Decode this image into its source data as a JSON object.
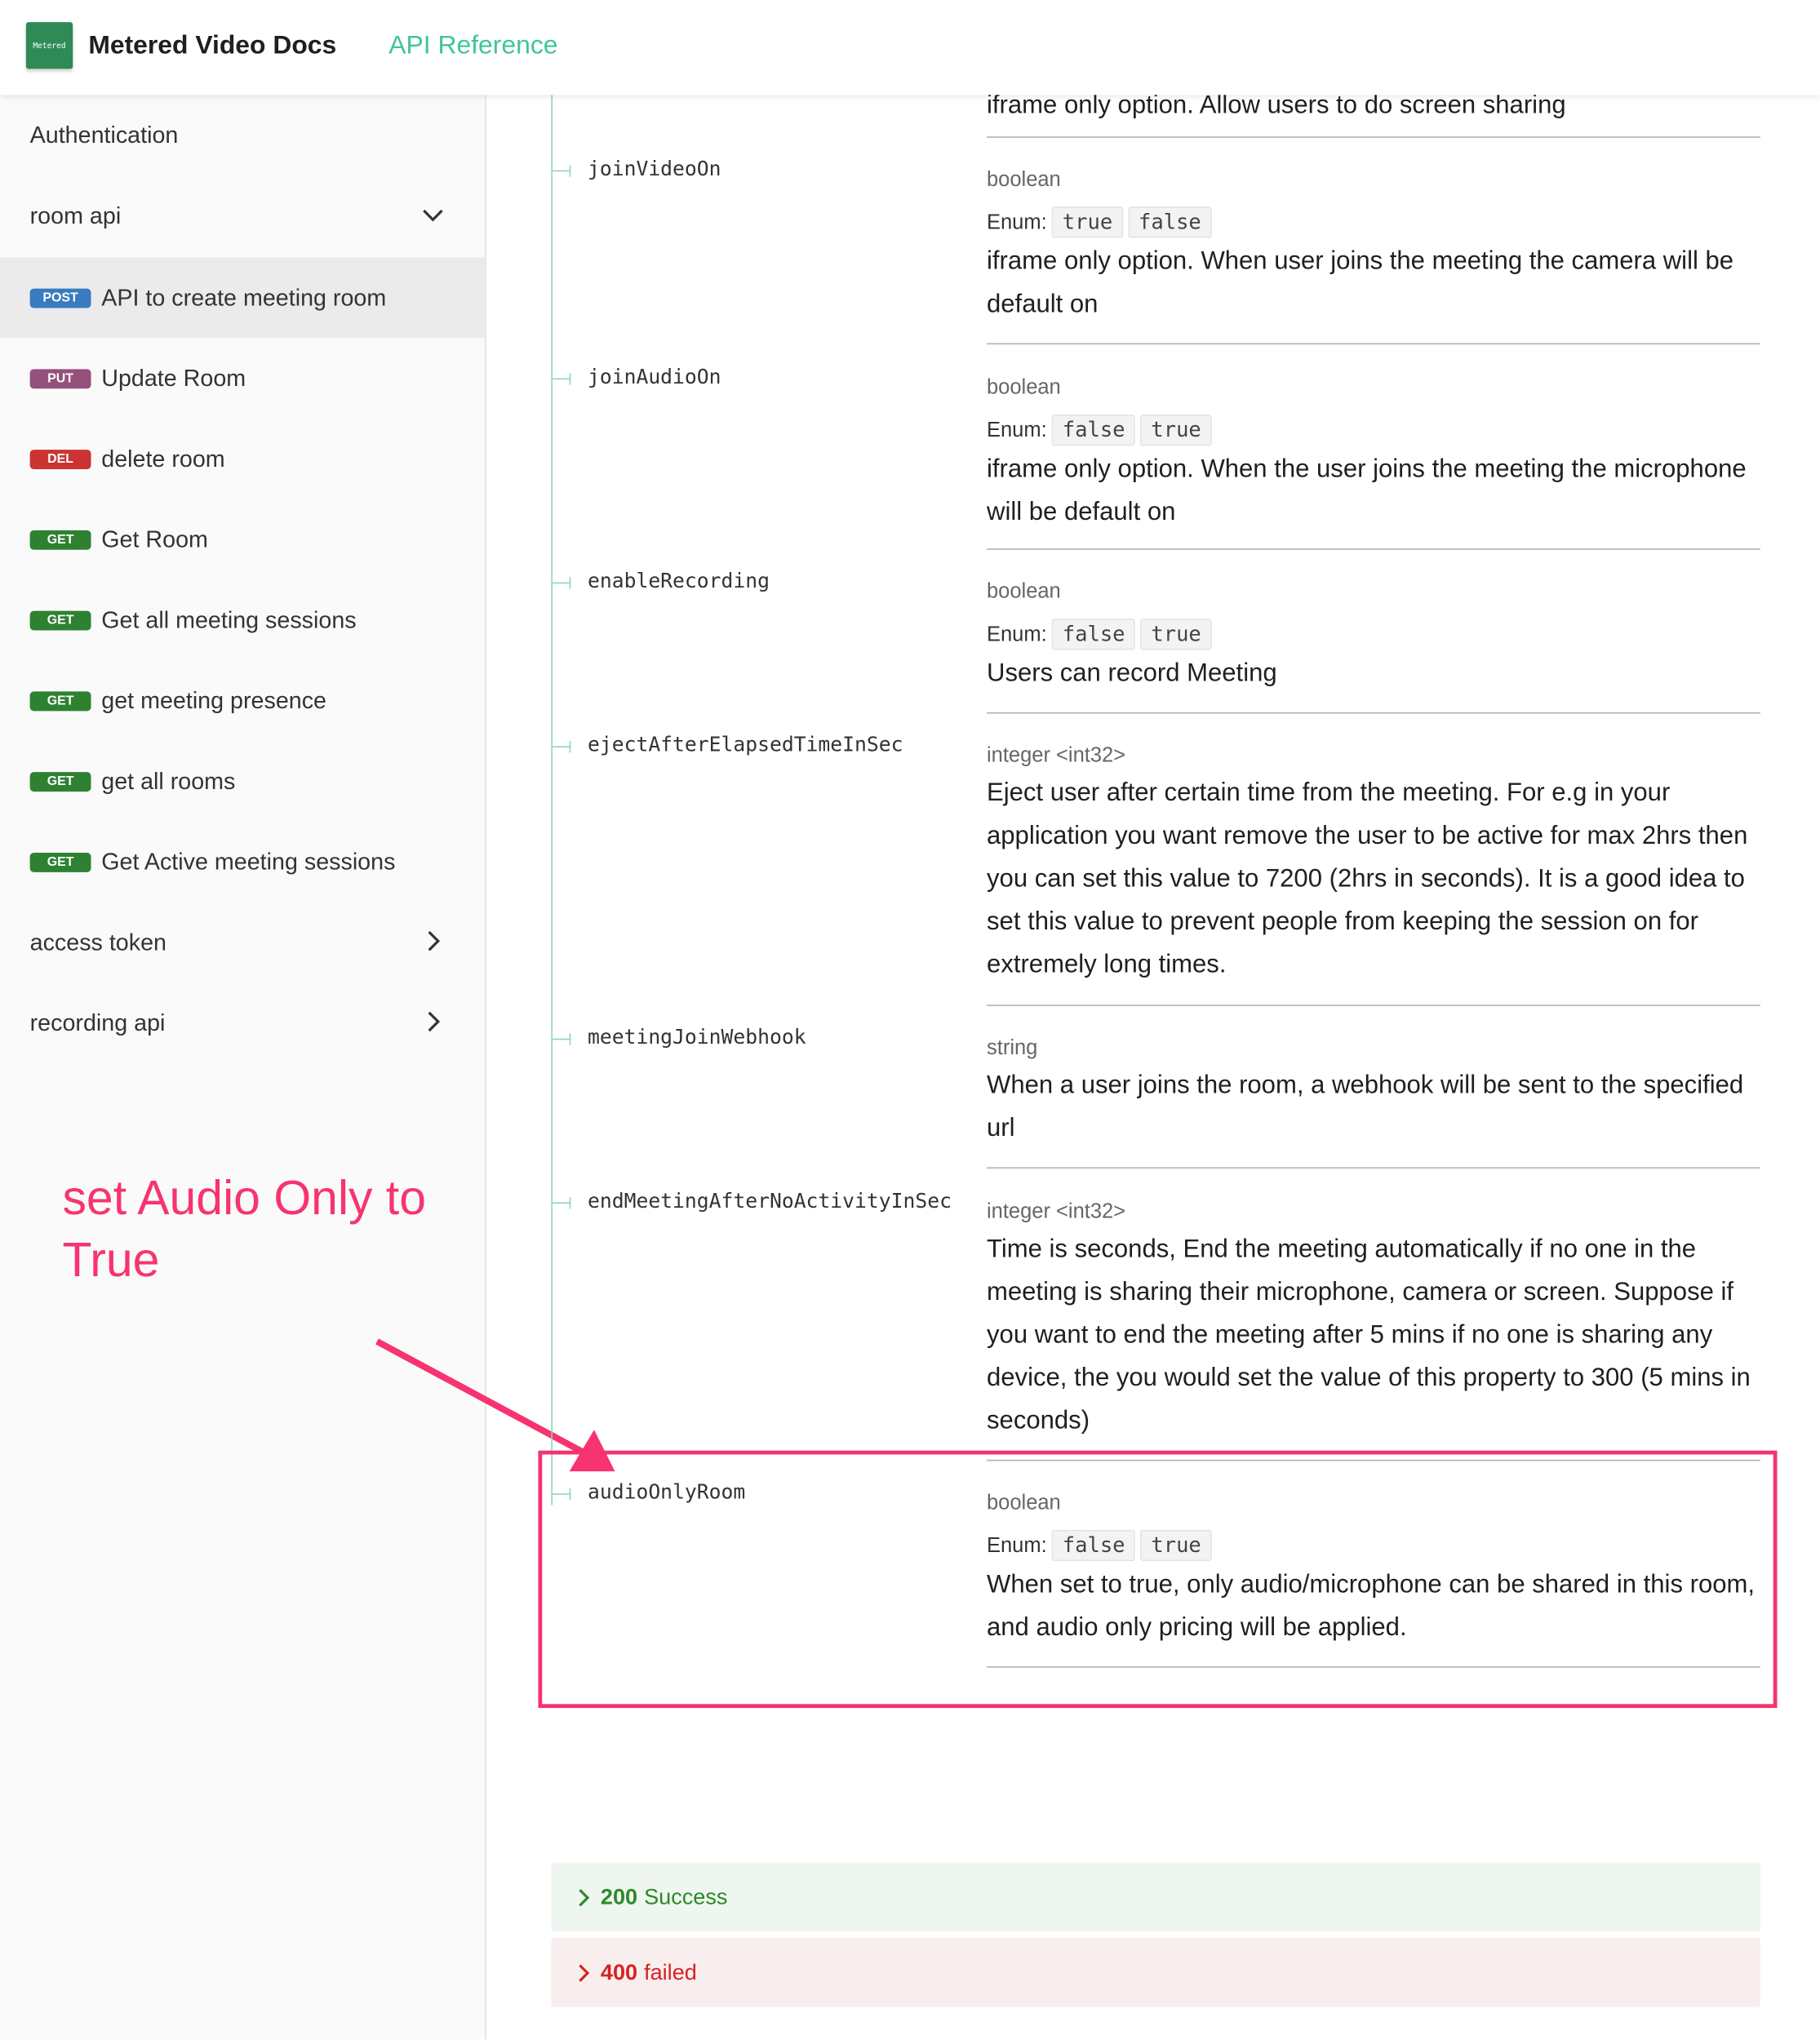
{
  "header": {
    "logo_text": "Metered",
    "brand": "Metered Video Docs",
    "api_reference": "API Reference"
  },
  "sidebar": {
    "items": [
      {
        "label": "Authentication"
      },
      {
        "label": "room api",
        "chevron": "chevron-down"
      },
      {
        "method": "POST",
        "label": "API to create meeting room",
        "active": true
      },
      {
        "method": "PUT",
        "label": "Update Room"
      },
      {
        "method": "DEL",
        "label": "delete room"
      },
      {
        "method": "GET",
        "label": "Get Room"
      },
      {
        "method": "GET",
        "label": "Get all meeting sessions"
      },
      {
        "method": "GET",
        "label": "get meeting presence"
      },
      {
        "method": "GET",
        "label": "get all rooms"
      },
      {
        "method": "GET",
        "label": "Get Active meeting sessions"
      },
      {
        "label": "access token",
        "chevron": "chevron-right"
      },
      {
        "label": "recording api",
        "chevron": "chevron-right"
      }
    ]
  },
  "method_colors": {
    "POST": "#3a7bbf",
    "PUT": "#95507c",
    "DEL": "#cc3333",
    "GET": "#2f8132"
  },
  "annotation": {
    "text": "set Audio Only to True",
    "color": "#f7346f"
  },
  "properties": {
    "partial_top": "iframe only option. Allow users to do screen sharing",
    "enum_label": "Enum:",
    "items": [
      {
        "name": "joinVideoOn",
        "type": "boolean",
        "enum": [
          "true",
          "false"
        ],
        "description": "iframe only option. When user joins the meeting the camera will be default on"
      },
      {
        "name": "joinAudioOn",
        "type": "boolean",
        "enum": [
          "false",
          "true"
        ],
        "description": "iframe only option. When the user joins the meeting the microphone will be default on"
      },
      {
        "name": "enableRecording",
        "type": "boolean",
        "enum": [
          "false",
          "true"
        ],
        "description": "Users can record Meeting"
      },
      {
        "name": "ejectAfterElapsedTimeInSec",
        "type": "integer <int32>",
        "description": "Eject user after certain time from the meeting. For e.g in your application you want remove the user to be active for max 2hrs then you can set this value to 7200 (2hrs in seconds). It is a good idea to set this value to prevent people from keeping the session on for extremely long times."
      },
      {
        "name": "meetingJoinWebhook",
        "type": "string",
        "description": "When a user joins the room, a webhook will be sent to the specified url"
      },
      {
        "name": "endMeetingAfterNoActivityInSec",
        "type": "integer <int32>",
        "description": "Time is seconds, End the meeting automatically if no one in the meeting is sharing their microphone, camera or screen. Suppose if you want to end the meeting after 5 mins if no one is sharing any device, the you would set the value of this property to 300 (5 mins in seconds)"
      },
      {
        "name": "audioOnlyRoom",
        "type": "boolean",
        "enum": [
          "false",
          "true"
        ],
        "description": "When set to true, only audio/microphone can be shared in this room, and audio only pricing will be applied.",
        "highlighted": true
      }
    ]
  },
  "responses": [
    {
      "code": "200",
      "label": "Success",
      "color": "#2a8a2a",
      "bg": "#eff5ef"
    },
    {
      "code": "400",
      "label": "failed",
      "color": "#d62222",
      "bg": "#f9eeee"
    }
  ]
}
